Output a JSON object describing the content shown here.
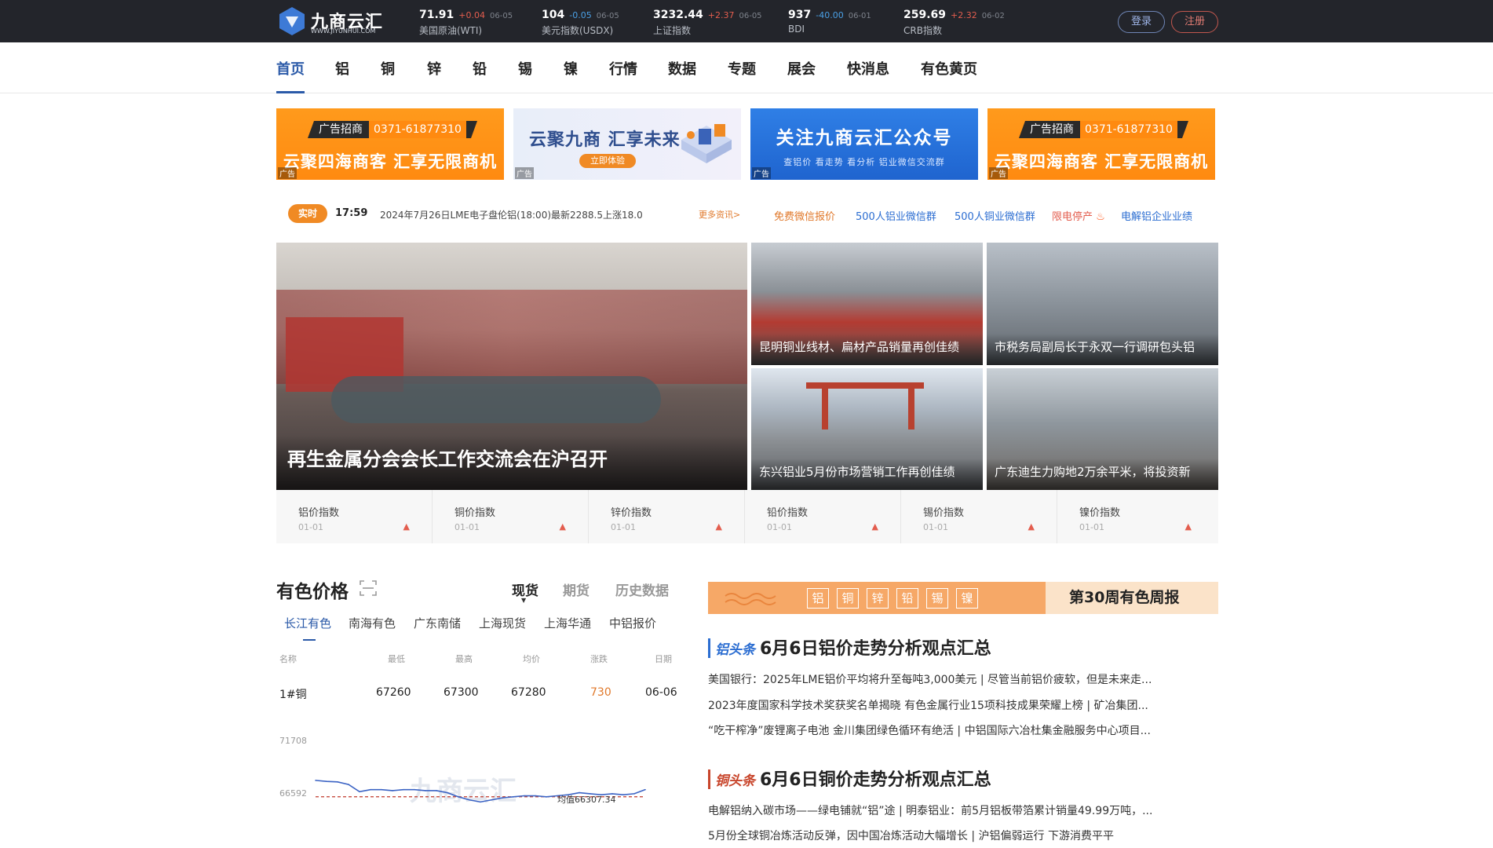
{
  "logo": {
    "title": "九商云汇",
    "sub": "WWW.JIYUNHUI.COM"
  },
  "indices": [
    {
      "value": "71.91",
      "change": "+0.04",
      "date": "06-05",
      "name": "美国原油(WTI)",
      "dir": "up"
    },
    {
      "value": "104",
      "change": "-0.05",
      "date": "06-05",
      "name": "美元指数(USDX)",
      "dir": "down"
    },
    {
      "value": "3232.44",
      "change": "+2.37",
      "date": "06-05",
      "name": "上证指数",
      "dir": "up"
    },
    {
      "value": "937",
      "change": "-40.00",
      "date": "06-01",
      "name": "BDI",
      "dir": "down"
    },
    {
      "value": "259.69",
      "change": "+2.32",
      "date": "06-02",
      "name": "CRB指数",
      "dir": "up"
    }
  ],
  "auth": {
    "login": "登录",
    "register": "注册"
  },
  "nav": [
    "首页",
    "铝",
    "铜",
    "锌",
    "铅",
    "锡",
    "镍",
    "行情",
    "数据",
    "专题",
    "展会",
    "快消息",
    "有色黄页"
  ],
  "ads": {
    "a1_tag": "广告招商",
    "a1_phone": "0371-61877310",
    "a1_text": "云聚四海商客 汇享无限商机",
    "ad_label": "广告",
    "a2_text": "云聚九商 汇享未来",
    "a2_btn": "立即体验",
    "a3_text": "关注九商云汇公众号",
    "a3_sub": "查铝价 看走势 看分析 铝业微信交流群"
  },
  "ticker": {
    "badge": "实时",
    "time": "17:59",
    "message": "2024年7月26日LME电子盘伦铝(18:00)最新2288.5上涨18.0",
    "more": "更多资讯>",
    "links": [
      "免费微信报价",
      "500人铝业微信群",
      "500人铜业微信群",
      "限电停产",
      "电解铝企业业绩"
    ]
  },
  "photos": {
    "main": "再生金属分会会长工作交流会在沪召开",
    "p1": "昆明铜业线材、扁材产品销量再创佳绩",
    "p2": "市税务局副局长于永双一行调研包头铝",
    "p3": "东兴铝业5月份市场营销工作再创佳绩",
    "p4": "广东迪生力购地2万余平米，将投资新"
  },
  "index_strip": [
    {
      "name": "铝价指数",
      "date": "01-01",
      "arrow": "▲"
    },
    {
      "name": "铜价指数",
      "date": "01-01",
      "arrow": "▲"
    },
    {
      "name": "锌价指数",
      "date": "01-01",
      "arrow": "▲"
    },
    {
      "name": "铅价指数",
      "date": "01-01",
      "arrow": "▲"
    },
    {
      "name": "锡价指数",
      "date": "01-01",
      "arrow": "▲"
    },
    {
      "name": "镍价指数",
      "date": "01-01",
      "arrow": "▲"
    }
  ],
  "price": {
    "title": "有色价格",
    "tabs": [
      "现货",
      "期货",
      "历史数据"
    ],
    "subtabs": [
      "长江有色",
      "南海有色",
      "广东南储",
      "上海现货",
      "上海华通",
      "中铝报价"
    ],
    "headers": [
      "名称",
      "最低",
      "最高",
      "均价",
      "涨跌",
      "日期"
    ],
    "row": [
      "1#铜",
      "67260",
      "67300",
      "67280",
      "730",
      "06-06"
    ],
    "watermark": "九商云汇",
    "avg_label": "均值66307.34"
  },
  "chart_data": {
    "type": "line",
    "y_ticks": [
      "71708",
      "66592"
    ],
    "avg": 66307.34,
    "values": [
      67900,
      67800,
      67750,
      67500,
      66800,
      67000,
      67000,
      66900,
      67000,
      67000,
      66900,
      66900,
      66700,
      66300,
      66000,
      65800,
      66000,
      66200,
      66300,
      66400,
      66400,
      66300,
      66400,
      66500,
      66700,
      66600,
      66500,
      66600,
      66500,
      66600,
      67000
    ]
  },
  "weekly": {
    "metals": [
      "铝",
      "铜",
      "锌",
      "铅",
      "锡",
      "镍"
    ],
    "title": "第30周有色周报"
  },
  "news": [
    {
      "tag": "铝头条",
      "title": "6月6日铝价走势分析观点汇总",
      "lines": [
        "美国银行：2025年LME铝价平均将升至每吨3,000美元  |  尽管当前铝价疲软，但是未来走...",
        "2023年度国家科学技术奖获奖名单揭晓 有色金属行业15项科技成果荣耀上榜  |  矿冶集团...",
        "“吃干榨净”废锂离子电池 金川集团绿色循环有绝活  |  中铝国际六冶杜集金融服务中心项目..."
      ]
    },
    {
      "tag": "铜头条",
      "title": "6月6日铜价走势分析观点汇总",
      "lines": [
        "电解铝纳入碳市场——绿电铺就“铝”途  |  明泰铝业：前5月铝板带箔累计销量49.99万吨，...",
        "5月份全球铜冶炼活动反弹，因中国冶炼活动大幅增长  |  沪铝偏弱运行 下游消费平平"
      ]
    }
  ],
  "colors": {
    "accent": "#2b5aa8",
    "orange": "#f08a24",
    "up": "#e35d4e",
    "down": "#4aa0e6"
  }
}
